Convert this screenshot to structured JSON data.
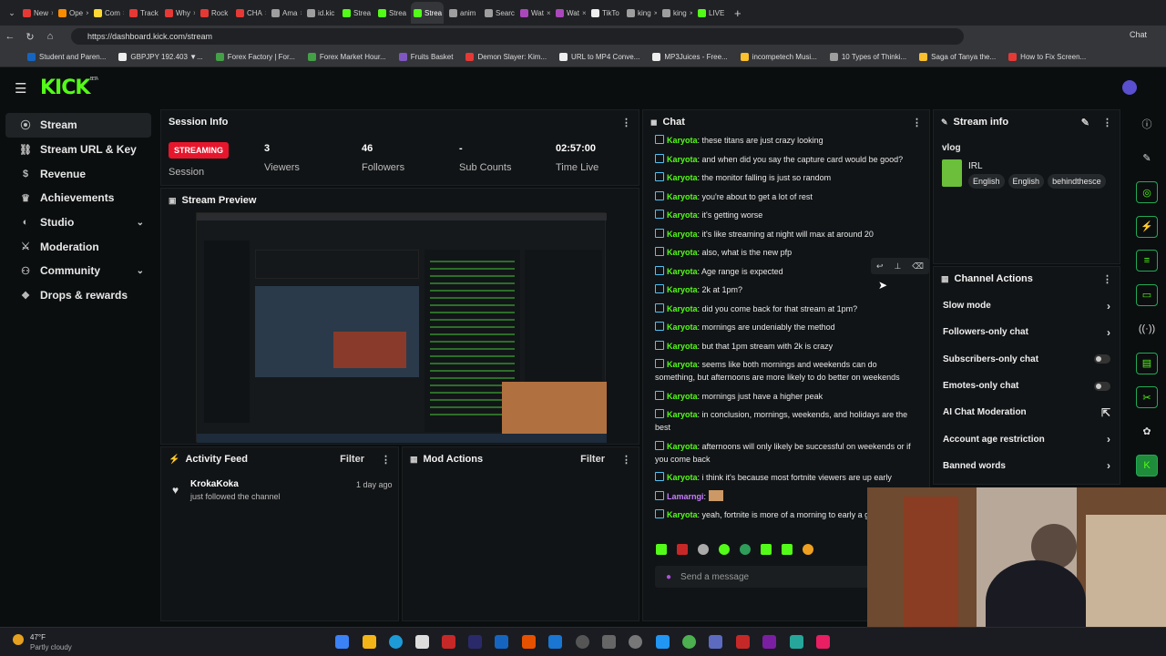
{
  "browser": {
    "tabs": [
      {
        "label": "New",
        "color": "#e53935"
      },
      {
        "label": "Ope",
        "color": "#fb8c00"
      },
      {
        "label": "Com",
        "color": "#fdd835"
      },
      {
        "label": "Track",
        "color": "#e53935"
      },
      {
        "label": "Why",
        "color": "#e53935"
      },
      {
        "label": "Rock",
        "color": "#e53935"
      },
      {
        "label": "CHA",
        "color": "#e53935"
      },
      {
        "label": "Ama",
        "color": "#9e9e9e"
      },
      {
        "label": "id.kic",
        "color": "#9e9e9e"
      },
      {
        "label": "Strea",
        "color": "#53fc18"
      },
      {
        "label": "Strea",
        "color": "#53fc18"
      },
      {
        "label": "Strea",
        "color": "#53fc18",
        "active": true
      },
      {
        "label": "anim",
        "color": "#9e9e9e"
      },
      {
        "label": "Searc",
        "color": "#9e9e9e"
      },
      {
        "label": "Wat",
        "color": "#ab47bc"
      },
      {
        "label": "Wat",
        "color": "#ab47bc"
      },
      {
        "label": "TikTo",
        "color": "#eeeeee"
      },
      {
        "label": "king",
        "color": "#9e9e9e"
      },
      {
        "label": "king",
        "color": "#9e9e9e"
      },
      {
        "label": "LIVE",
        "color": "#53fc18"
      }
    ],
    "url": "https://dashboard.kick.com/stream",
    "chat_label": "Chat",
    "bookmarks": [
      {
        "label": "Student and Paren...",
        "color": "#1565c0"
      },
      {
        "label": "GBPJPY 192.403 ▼...",
        "color": "#eeeeee"
      },
      {
        "label": "Forex Factory | For...",
        "color": "#43a047"
      },
      {
        "label": "Forex Market Hour...",
        "color": "#43a047"
      },
      {
        "label": "Fruits Basket",
        "color": "#7e57c2"
      },
      {
        "label": "Demon Slayer: Kim...",
        "color": "#e53935"
      },
      {
        "label": "URL to MP4 Conve...",
        "color": "#eeeeee"
      },
      {
        "label": "MP3Juices - Free...",
        "color": "#eeeeee"
      },
      {
        "label": "incompetech Musi...",
        "color": "#fbc02d"
      },
      {
        "label": "10 Types of Thinki...",
        "color": "#9e9e9e"
      },
      {
        "label": "Saga of Tanya the...",
        "color": "#fbc02d"
      },
      {
        "label": "How to Fix Screen...",
        "color": "#e53935"
      }
    ]
  },
  "brand": {
    "logo": "KICK",
    "beta": "BETA",
    "accent": "#53fc18"
  },
  "sidebar": {
    "items": [
      {
        "label": "Stream",
        "icon": "broadcast-icon",
        "active": true
      },
      {
        "label": "Stream URL & Key",
        "icon": "link-icon"
      },
      {
        "label": "Revenue",
        "icon": "dollar-icon"
      },
      {
        "label": "Achievements",
        "icon": "trophy-icon"
      },
      {
        "label": "Studio",
        "icon": "studio-icon",
        "chevron": true
      },
      {
        "label": "Moderation",
        "icon": "sword-icon"
      },
      {
        "label": "Community",
        "icon": "community-icon",
        "chevron": true
      },
      {
        "label": "Drops & rewards",
        "icon": "gift-icon"
      }
    ]
  },
  "session": {
    "title": "Session Info",
    "status": "STREAMING",
    "status_label": "Session",
    "stats": [
      {
        "value": "3",
        "label": "Viewers"
      },
      {
        "value": "46",
        "label": "Followers"
      },
      {
        "value": "-",
        "label": "Sub Counts"
      },
      {
        "value": "02:57:00",
        "label": "Time Live"
      }
    ]
  },
  "preview": {
    "title": "Stream Preview"
  },
  "activity": {
    "title": "Activity Feed",
    "filter": "Filter",
    "items": [
      {
        "user": "KrokaKoka",
        "text": "just followed the channel",
        "time": "1 day ago"
      }
    ]
  },
  "mod": {
    "title": "Mod Actions",
    "filter": "Filter"
  },
  "chat": {
    "title": "Chat",
    "messages": [
      {
        "user": "Karyota",
        "text": "these titans are just crazy looking"
      },
      {
        "user": "Karyota",
        "text": "and when did you say the capture card would be good?"
      },
      {
        "user": "Karyota",
        "text": "the monitor falling is just so random"
      },
      {
        "user": "Karyota",
        "text": "you're about to get a lot of rest"
      },
      {
        "user": "Karyota",
        "text": "it's getting worse"
      },
      {
        "user": "Karyota",
        "text": "it's like streaming at night will max at around 20"
      },
      {
        "user": "Karyota",
        "text": "also, what is the new pfp"
      },
      {
        "user": "Karyota",
        "text": "Age range is expected"
      },
      {
        "user": "Karyota",
        "text": "2k at 1pm?"
      },
      {
        "user": "Karyota",
        "text": "did you come back for that stream at 1pm?"
      },
      {
        "user": "Karyota",
        "text": "mornings are undeniably the method"
      },
      {
        "user": "Karyota",
        "text": "but that 1pm stream with 2k is crazy"
      },
      {
        "user": "Karyota",
        "text": "seems like both mornings and weekends can do something, but afternoons are more likely to do better on weekends"
      },
      {
        "user": "Karyota",
        "text": "mornings just have a higher peak"
      },
      {
        "user": "Karyota",
        "text": "in conclusion, mornings, weekends, and holidays are the best"
      },
      {
        "user": "Karyota",
        "text": "afternoons will only likely be successful on weekends or if you come back"
      },
      {
        "user": "Karyota",
        "text": "i think it's because most fortnite viewers are up early"
      },
      {
        "user": "Lamarngi",
        "text": ""
      },
      {
        "user": "Karyota",
        "text": "yeah, fortnite is more of a morning to early a game"
      }
    ],
    "input_placeholder": "Send a message"
  },
  "stream_info": {
    "title": "Stream info",
    "stream_title": "vlog",
    "category": "IRL",
    "tags": [
      "English",
      "English",
      "behindthesce"
    ]
  },
  "channel_actions": {
    "title": "Channel Actions",
    "items": [
      {
        "label": "Slow mode",
        "control": "arrow"
      },
      {
        "label": "Followers-only chat",
        "control": "arrow"
      },
      {
        "label": "Subscribers-only chat",
        "control": "toggle"
      },
      {
        "label": "Emotes-only chat",
        "control": "toggle"
      },
      {
        "label": "AI Chat Moderation",
        "control": "external"
      },
      {
        "label": "Account age restriction",
        "control": "arrow"
      },
      {
        "label": "Banned words",
        "control": "arrow"
      }
    ]
  },
  "weather": {
    "temp": "47°F",
    "condition": "Partly cloudy"
  }
}
